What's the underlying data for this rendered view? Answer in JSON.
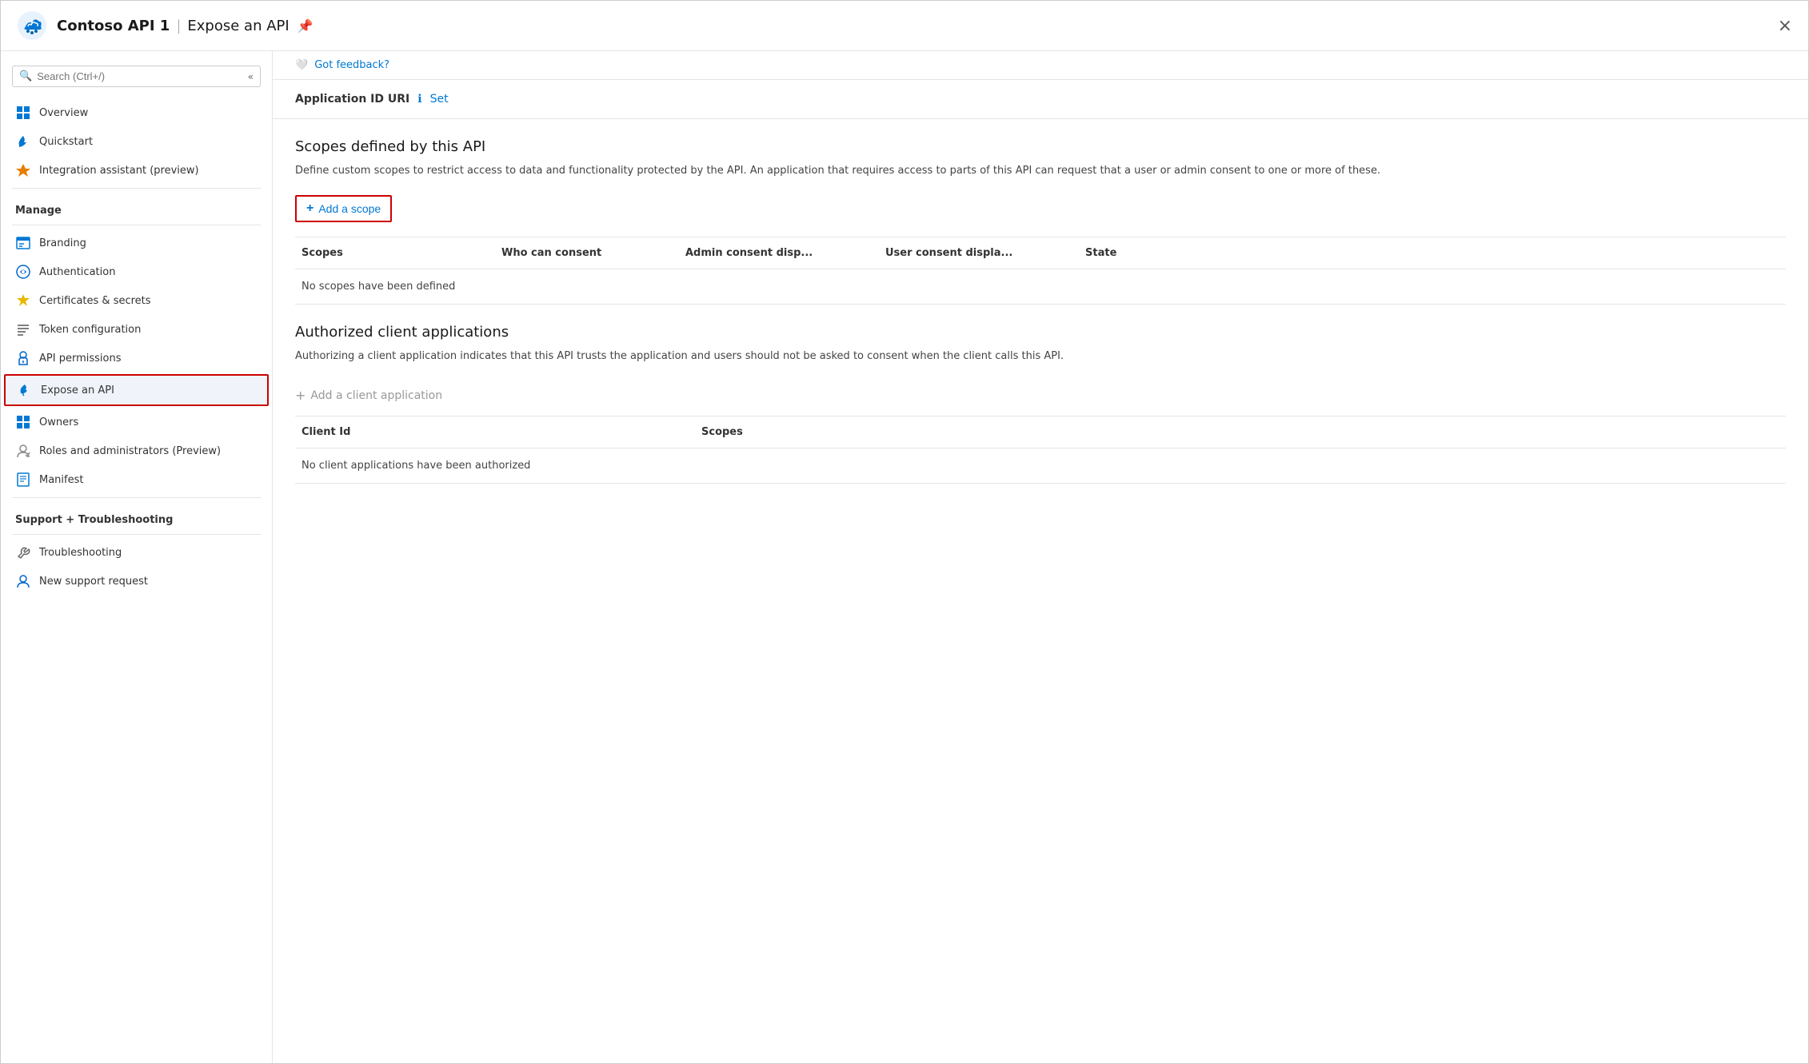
{
  "header": {
    "app_name": "Contoso API 1",
    "separator": "|",
    "page_title": "Expose an API",
    "close_label": "×"
  },
  "search": {
    "placeholder": "Search (Ctrl+/)"
  },
  "sidebar": {
    "nav_items": [
      {
        "id": "overview",
        "label": "Overview",
        "icon": "grid"
      },
      {
        "id": "quickstart",
        "label": "Quickstart",
        "icon": "cloud"
      },
      {
        "id": "integration",
        "label": "Integration assistant (preview)",
        "icon": "rocket"
      }
    ],
    "manage_label": "Manage",
    "manage_items": [
      {
        "id": "branding",
        "label": "Branding",
        "icon": "branding"
      },
      {
        "id": "authentication",
        "label": "Authentication",
        "icon": "auth"
      },
      {
        "id": "certs",
        "label": "Certificates & secrets",
        "icon": "key"
      },
      {
        "id": "token",
        "label": "Token configuration",
        "icon": "bars"
      },
      {
        "id": "api-permissions",
        "label": "API permissions",
        "icon": "shield"
      },
      {
        "id": "expose-api",
        "label": "Expose an API",
        "icon": "cloud-expose",
        "active": true
      },
      {
        "id": "owners",
        "label": "Owners",
        "icon": "grid-owners"
      },
      {
        "id": "roles",
        "label": "Roles and administrators (Preview)",
        "icon": "person"
      },
      {
        "id": "manifest",
        "label": "Manifest",
        "icon": "manifest"
      }
    ],
    "support_label": "Support + Troubleshooting",
    "support_items": [
      {
        "id": "troubleshooting",
        "label": "Troubleshooting",
        "icon": "wrench"
      },
      {
        "id": "new-support",
        "label": "New support request",
        "icon": "person-support"
      }
    ]
  },
  "main": {
    "feedback": {
      "label": "Got feedback?"
    },
    "app_id_uri": {
      "label": "Application ID URI",
      "set_label": "Set"
    },
    "scopes_section": {
      "title": "Scopes defined by this API",
      "description": "Define custom scopes to restrict access to data and functionality protected by the API. An application that requires access to parts of this API can request that a user or admin consent to one or more of these.",
      "add_scope_label": "Add a scope",
      "table_headers": [
        "Scopes",
        "Who can consent",
        "Admin consent disp...",
        "User consent displa...",
        "State"
      ],
      "empty_message": "No scopes have been defined"
    },
    "auth_client_section": {
      "title": "Authorized client applications",
      "description": "Authorizing a client application indicates that this API trusts the application and users should not be asked to consent when the client calls this API.",
      "add_client_label": "Add a client application",
      "table_headers": [
        "Client Id",
        "Scopes"
      ],
      "empty_message": "No client applications have been authorized"
    }
  }
}
